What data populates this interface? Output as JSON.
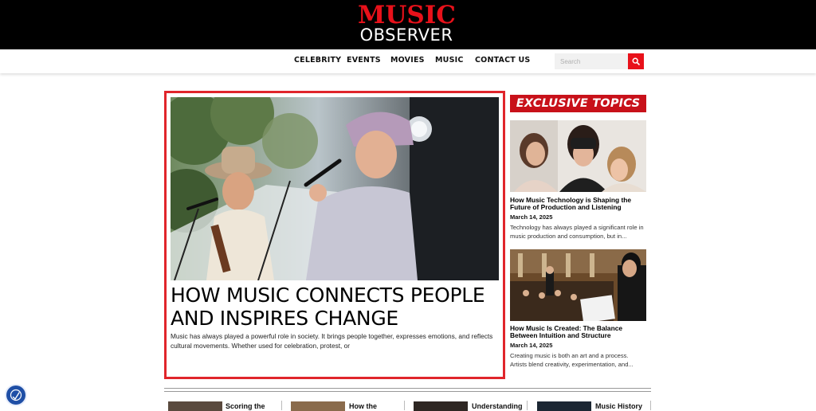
{
  "site": {
    "logo_line1": "MUSIC",
    "logo_line2": "OBSERVER"
  },
  "nav": {
    "items": [
      "CELEBRITY",
      "EVENTS",
      "MOVIES",
      "MUSIC",
      "CONTACT US"
    ]
  },
  "search": {
    "placeholder": "Search",
    "value": ""
  },
  "featured": {
    "title": "HOW MUSIC CONNECTS PEOPLE AND INSPIRES CHANGE",
    "excerpt": "Music has always played a powerful role in society. It brings people together, expresses emotions, and reflects cultural movements. Whether used for celebration, protest, or"
  },
  "sidebar": {
    "badge": "EXCLUSIVE TOPICS",
    "articles": [
      {
        "title": "How Music Technology is Shaping the Future of Production and Listening",
        "date": "March 14, 2025",
        "excerpt": "Technology has always played a significant role in music production and consumption, but in..."
      },
      {
        "title": "How Music Is Created: The Balance Between Intuition and Structure",
        "date": "March 14, 2025",
        "excerpt": "Creating music is both an art and a process. Artists blend creativity, experimentation, and..."
      }
    ]
  },
  "bottom_strip": {
    "items": [
      "Scoring the",
      "How the",
      "Understanding",
      "Music History"
    ]
  },
  "colors": {
    "brand_red": "#e8111a",
    "header_bg": "#000000",
    "accessibility_blue": "#1f4fa6"
  },
  "icons": {
    "search": "search-icon",
    "accessibility": "accessibility-icon"
  }
}
